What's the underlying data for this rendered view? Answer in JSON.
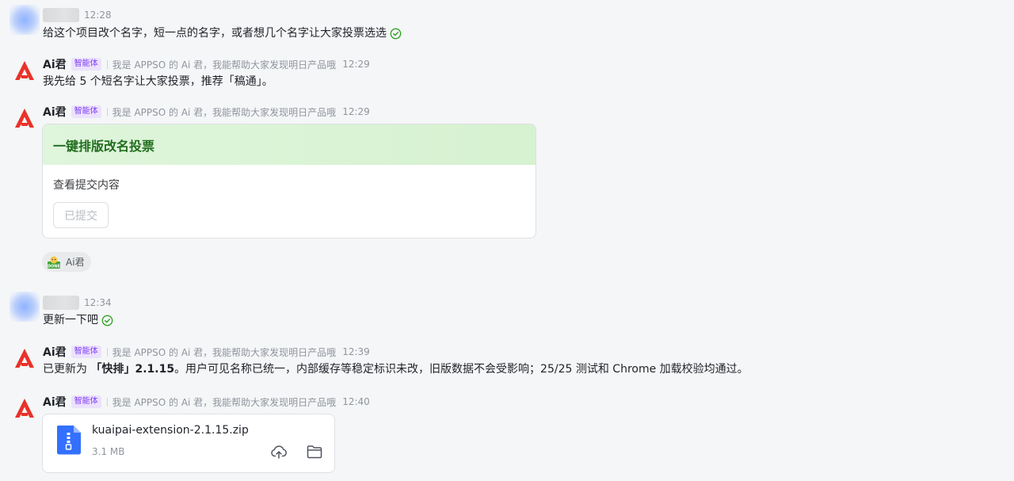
{
  "messages": {
    "m1": {
      "time": "12:28",
      "text": "给这个项目改个名字，短一点的名字，或者想几个名字让大家投票选选"
    },
    "m2": {
      "bot_name": "Ai君",
      "badge": "智能体",
      "desc": "我是 APPSO 的 Ai 君，我能帮助大家发现明日产品哦",
      "time": "12:29",
      "text": "我先给 5 个短名字让大家投票，推荐「稿通」。"
    },
    "m3": {
      "bot_name": "Ai君",
      "badge": "智能体",
      "desc": "我是 APPSO 的 Ai 君，我能帮助大家发现明日产品哦",
      "time": "12:29",
      "card": {
        "title": "一键排版改名投票",
        "label": "查看提交内容",
        "button": "已提交"
      },
      "reaction": {
        "user": "Ai君"
      }
    },
    "m4": {
      "time": "12:34",
      "text": "更新一下吧"
    },
    "m5": {
      "bot_name": "Ai君",
      "badge": "智能体",
      "desc": "我是 APPSO 的 Ai 君，我能帮助大家发现明日产品哦",
      "time": "12:39",
      "text_pre": "已更新为 ",
      "text_bold": "「快排」2.1.15",
      "text_post": "。用户可见名称已统一，内部缓存等稳定标识未改，旧版数据不会受影响；25/25 测试和 Chrome 加载校验均通过。"
    },
    "m6": {
      "bot_name": "Ai君",
      "badge": "智能体",
      "desc": "我是 APPSO 的 Ai 君，我能帮助大家发现明日产品哦",
      "time": "12:40",
      "file": {
        "name": "kuaipai-extension-2.1.15.zip",
        "size": "3.1 MB"
      }
    }
  },
  "colors": {
    "accent_green": "#216e1e",
    "badge_purple": "#7f3bf5",
    "check_green": "#2ea121",
    "logo_red": "#e8332a",
    "file_blue": "#3370ff"
  },
  "icons": {
    "check": "check-circle-icon",
    "logo": "appso-logo-icon",
    "reaction": "done-emoji-icon",
    "file": "zip-file-icon",
    "upload": "cloud-upload-icon",
    "folder": "folder-icon"
  }
}
